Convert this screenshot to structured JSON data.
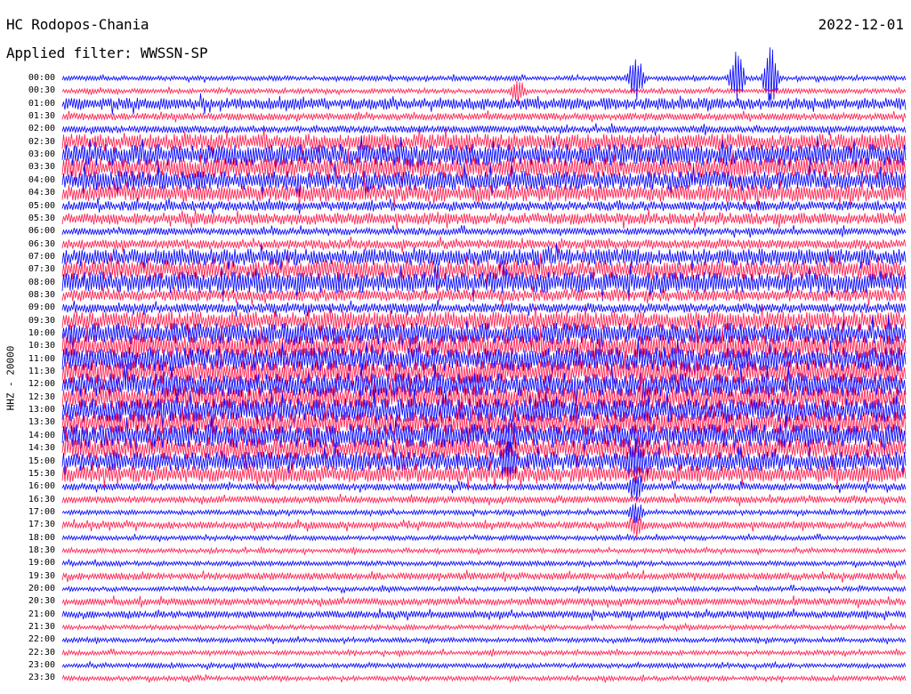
{
  "header": {
    "station": "HC Rodopos-Chania",
    "filter": "Applied filter: WWSSN-SP",
    "date": "2022-12-01"
  },
  "chart_data": {
    "type": "line",
    "title": "HC Rodopos-Chania",
    "subtitle": "Applied filter: WWSSN-SP",
    "date": "2022-12-01",
    "ylabel": "HHZ - 20000",
    "tick_labels": [
      "00:00",
      "00:30",
      "01:00",
      "01:30",
      "02:00",
      "02:30",
      "03:00",
      "03:30",
      "04:00",
      "04:30",
      "05:00",
      "05:30",
      "06:00",
      "06:30",
      "07:00",
      "07:30",
      "08:00",
      "08:30",
      "09:00",
      "09:30",
      "10:00",
      "10:30",
      "11:00",
      "11:30",
      "12:00",
      "12:30",
      "13:00",
      "13:30",
      "14:00",
      "14:30",
      "15:00",
      "15:30",
      "16:00",
      "16:30",
      "17:00",
      "17:30",
      "18:00",
      "18:30",
      "19:00",
      "19:30",
      "20:00",
      "20:30",
      "21:00",
      "21:30",
      "22:00",
      "22:30",
      "23:00",
      "23:30"
    ],
    "series_colors": [
      "#0000ff",
      "#ff1a4b"
    ],
    "trace_amplitude": [
      2,
      2,
      5,
      3,
      3,
      7,
      9,
      9,
      8,
      7,
      4,
      5,
      3,
      4,
      7,
      8,
      9,
      5,
      4,
      8,
      9,
      10,
      10,
      10,
      10,
      10,
      10,
      10,
      10,
      9,
      8,
      7,
      3,
      3,
      2,
      3,
      2,
      2,
      2,
      3,
      2,
      3,
      3,
      2,
      2,
      2,
      2,
      2
    ],
    "events": [
      {
        "trace": 0,
        "position": 0.68,
        "spike": 30
      },
      {
        "trace": 0,
        "position": 0.8,
        "spike": 34
      },
      {
        "trace": 0,
        "position": 0.84,
        "spike": 40
      },
      {
        "trace": 1,
        "position": 0.54,
        "spike": 14
      },
      {
        "trace": 28,
        "position": 0.53,
        "spike": 12
      },
      {
        "trace": 30,
        "position": 0.53,
        "spike": 18
      },
      {
        "trace": 30,
        "position": 0.68,
        "spike": 20
      },
      {
        "trace": 32,
        "position": 0.68,
        "spike": 16
      },
      {
        "trace": 34,
        "position": 0.68,
        "spike": 14
      },
      {
        "trace": 35,
        "position": 0.68,
        "spike": 12
      }
    ]
  }
}
